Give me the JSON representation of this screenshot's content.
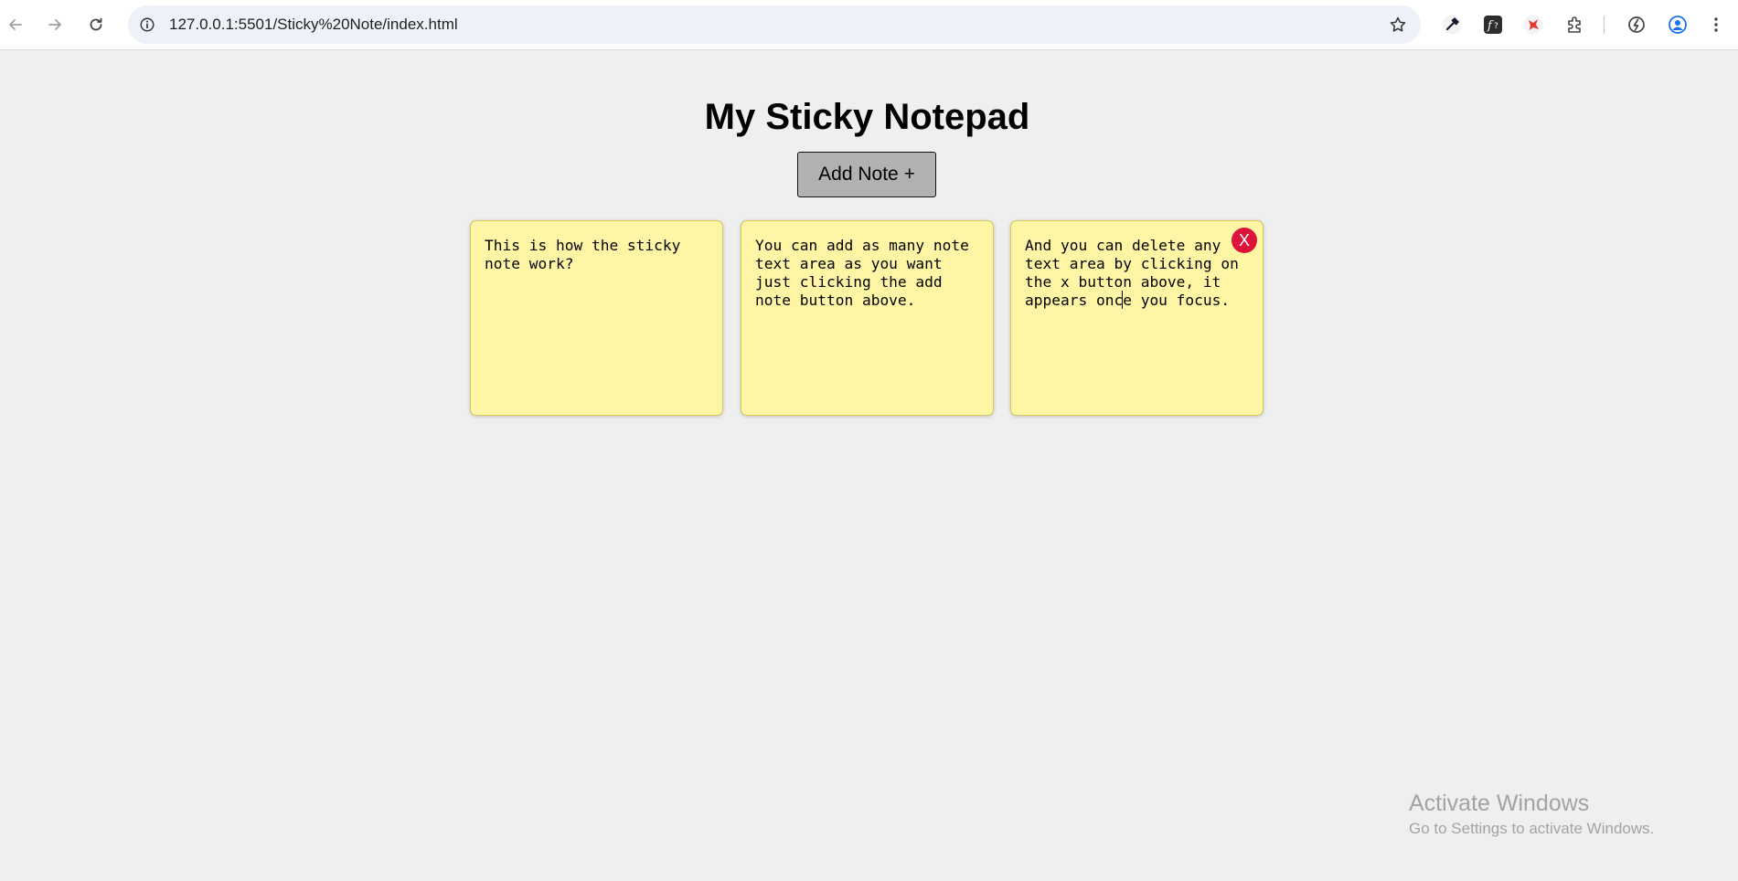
{
  "browser": {
    "url": "127.0.0.1:5501/Sticky%20Note/index.html"
  },
  "page": {
    "title": "My Sticky Notepad",
    "add_button_label": "Add Note +"
  },
  "notes": [
    {
      "text": "This is how the sticky\nnote work?"
    },
    {
      "text": "You can add as many note\ntext area as you want\njust clicking the add\nnote button above."
    },
    {
      "text": "And you can delete any\ntext area by clicking on\nthe x button above, it\nappears once you focus.",
      "delete_label": "X"
    }
  ],
  "watermark": {
    "title": "Activate Windows",
    "subtitle": "Go to Settings to activate Windows."
  },
  "colors": {
    "page_background": "#efefef",
    "note_background": "#fff6a5",
    "delete_button": "#dc143c",
    "add_button": "#b3b0b3"
  }
}
